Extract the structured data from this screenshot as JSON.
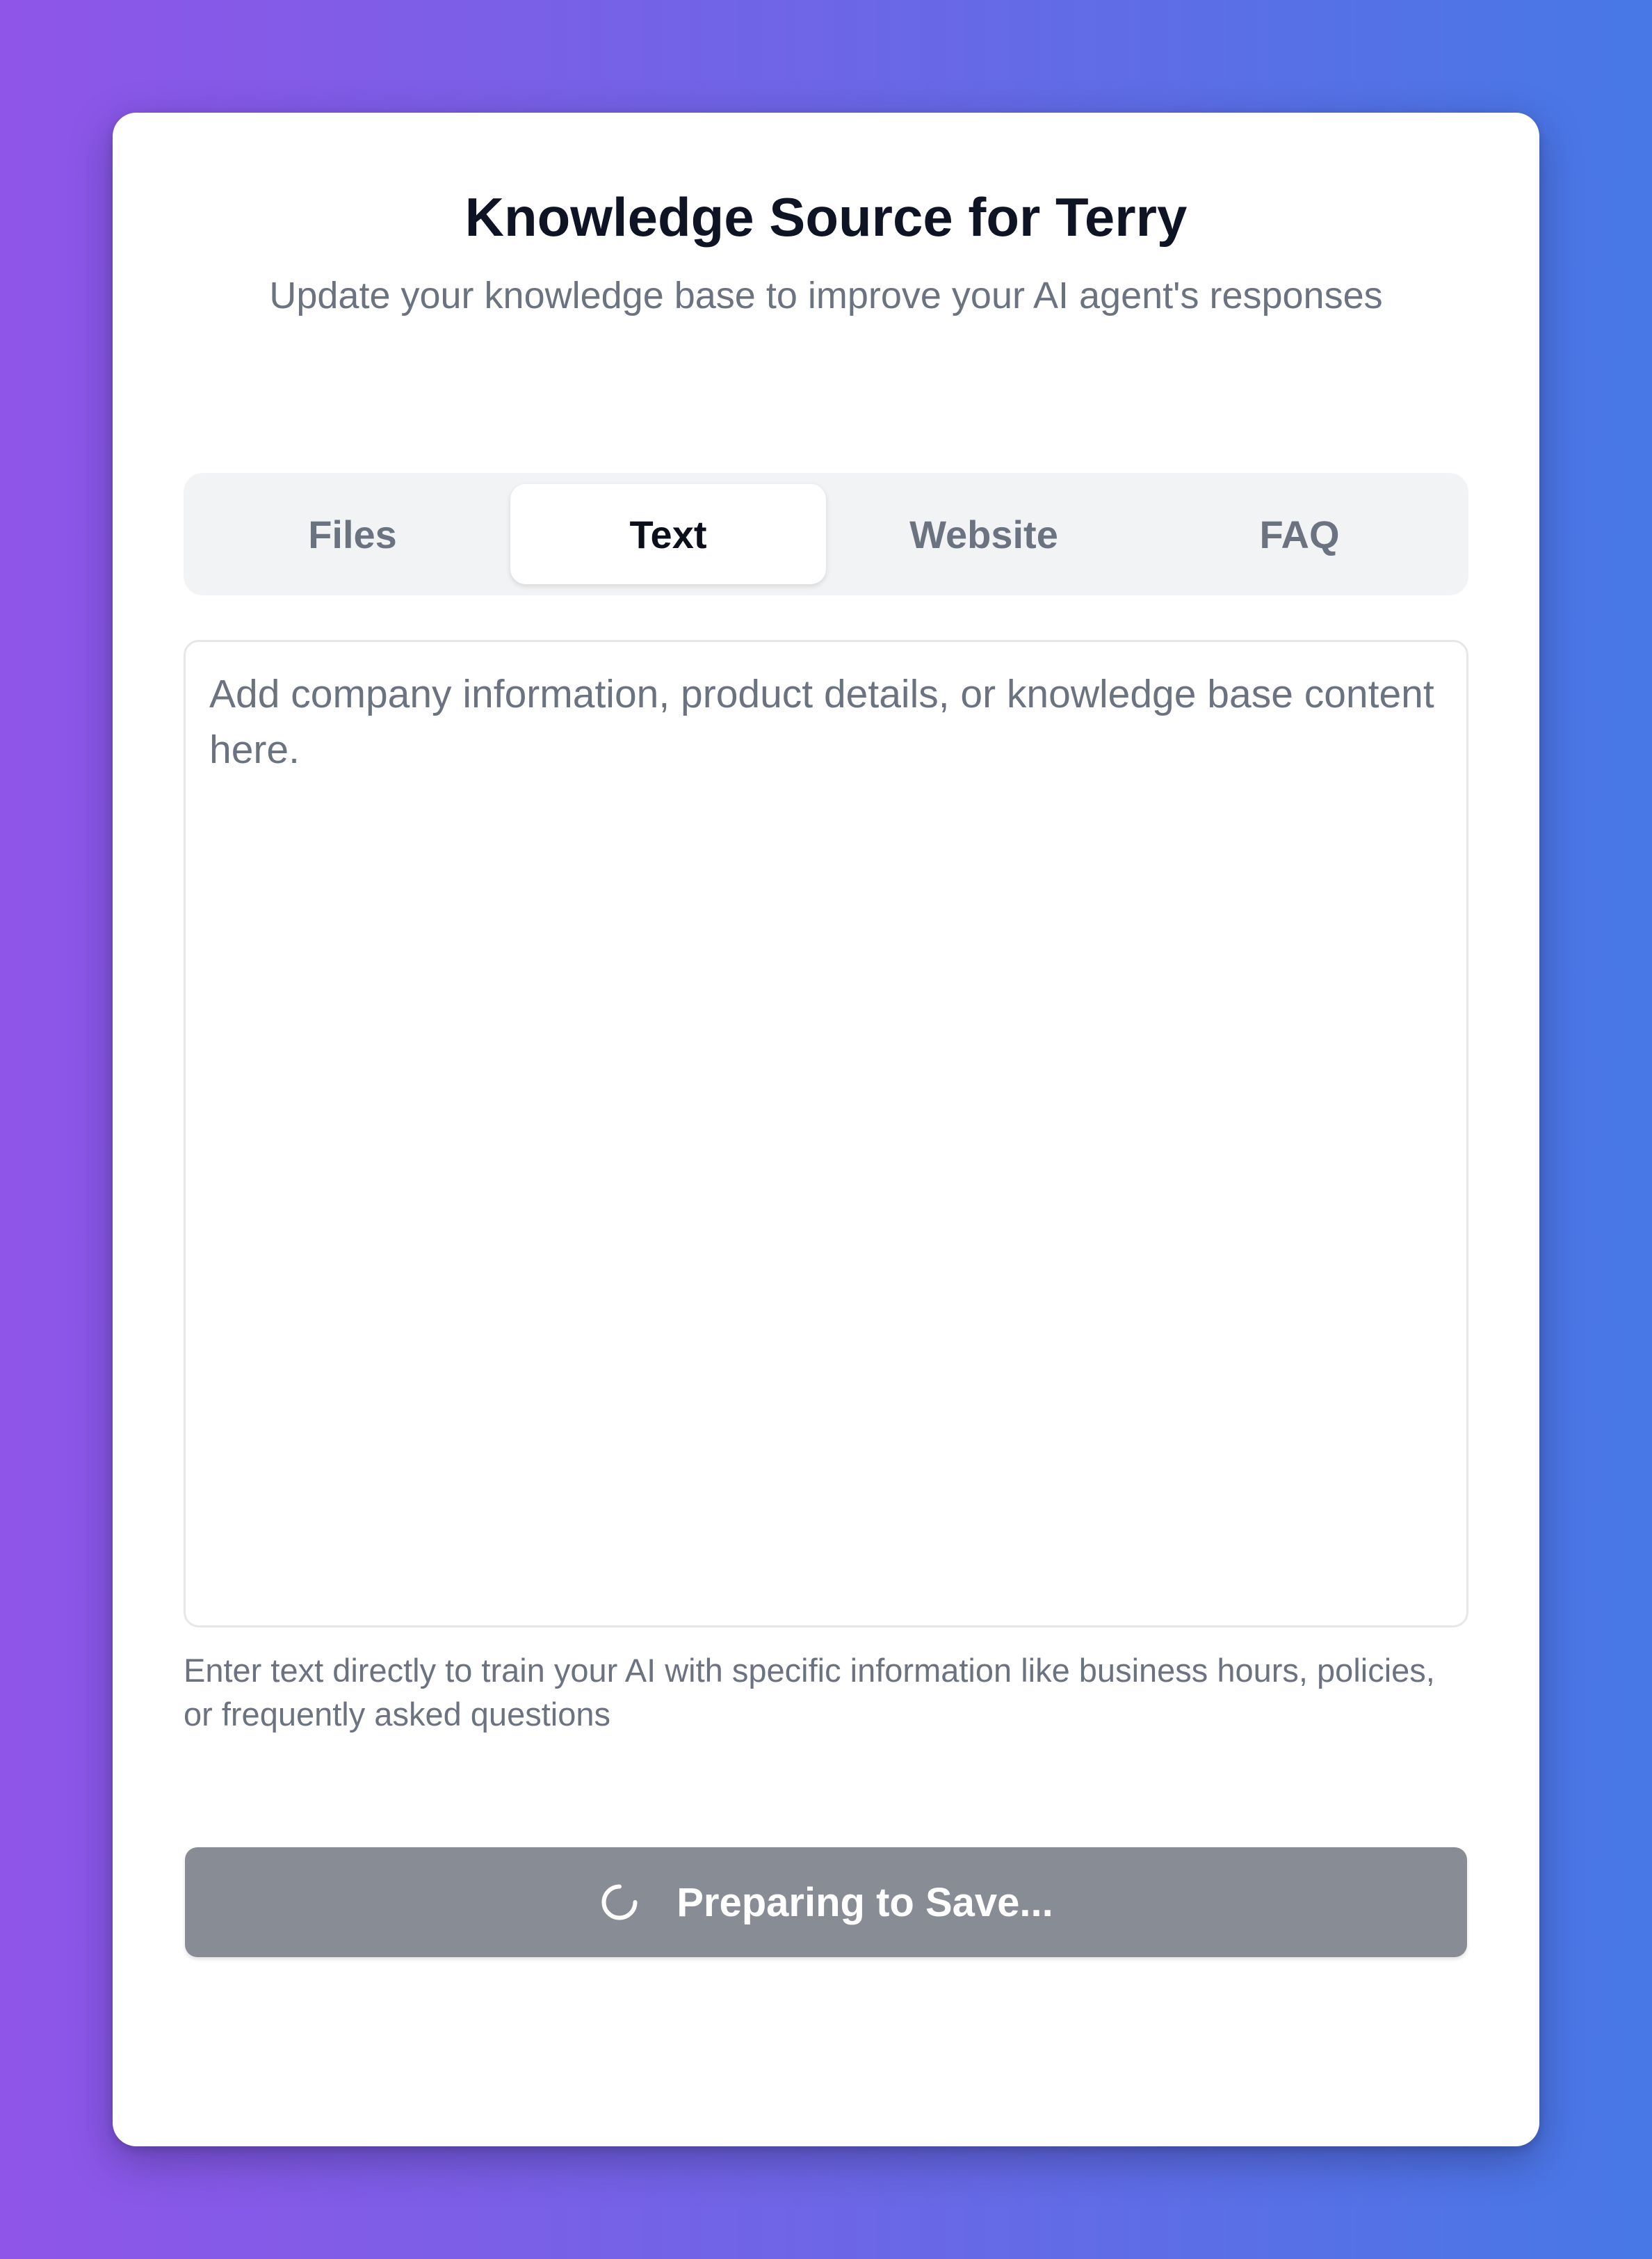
{
  "header": {
    "title": "Knowledge Source for Terry",
    "subtitle": "Update your knowledge base to improve your AI agent's responses"
  },
  "tabs": [
    {
      "label": "Files",
      "active": false
    },
    {
      "label": "Text",
      "active": true
    },
    {
      "label": "Website",
      "active": false
    },
    {
      "label": "FAQ",
      "active": false
    }
  ],
  "text_input": {
    "value": "",
    "placeholder": "Add company information, product details, or knowledge base content here."
  },
  "helper_text": "Enter text directly to train your AI with specific information like business hours, policies, or frequently asked questions",
  "save_button": {
    "label": "Preparing to Save...",
    "icon": "spinner-icon",
    "state": "loading"
  },
  "colors": {
    "background_gradient_start": "#8f55e8",
    "background_gradient_end": "#4778e6",
    "button_disabled": "#888d95",
    "tab_track": "#f2f3f5",
    "muted_text": "#6b7280"
  }
}
